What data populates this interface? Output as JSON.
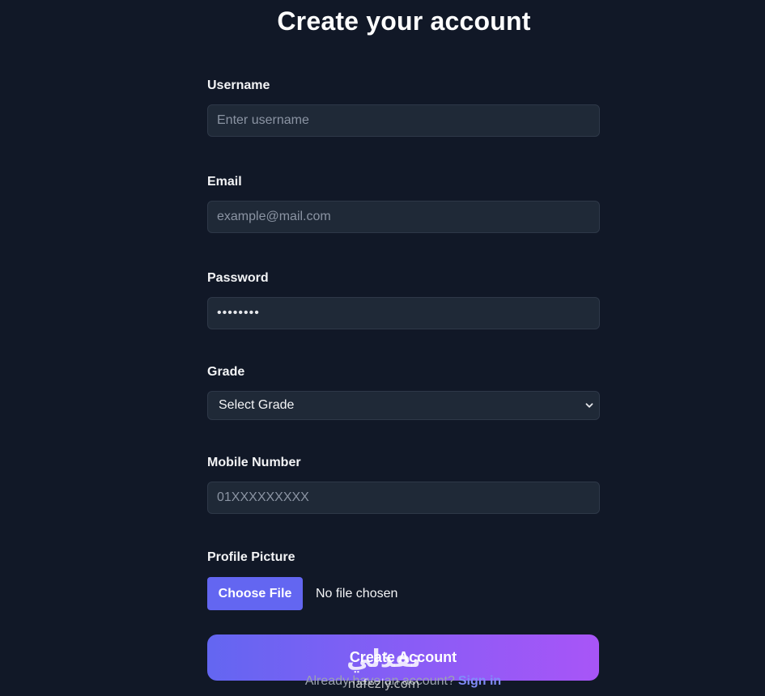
{
  "page": {
    "title": "Create your account"
  },
  "form": {
    "username": {
      "label": "Username",
      "placeholder": "Enter username"
    },
    "email": {
      "label": "Email",
      "placeholder": "example@mail.com"
    },
    "password": {
      "label": "Password",
      "value": "••••••••"
    },
    "grade": {
      "label": "Grade",
      "selected": "Select Grade",
      "icon": "chevron-down-icon"
    },
    "mobile": {
      "label": "Mobile Number",
      "placeholder": "01XXXXXXXXX"
    },
    "profile_picture": {
      "label": "Profile Picture",
      "button_label": "Choose File",
      "status": "No file chosen"
    },
    "submit_label": "Create Account"
  },
  "footer": {
    "prompt": "Already have an account?",
    "link_label": "Sign in"
  },
  "watermark": {
    "arabic": "نفذلي",
    "latin": "nafezly.com"
  },
  "colors": {
    "background": "#111827",
    "input_background": "#1f2937",
    "accent": "#6366f1",
    "gradient_end": "#a855f7",
    "link": "#818cf8"
  }
}
